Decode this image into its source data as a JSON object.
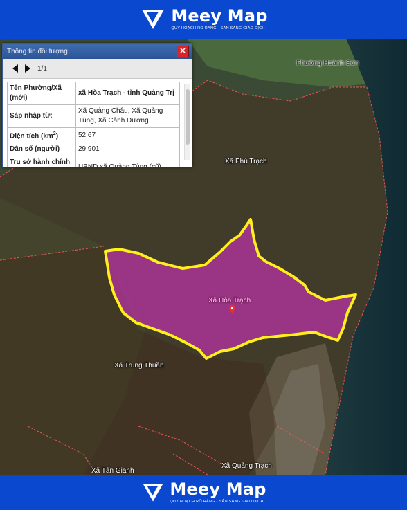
{
  "brand": {
    "name": "Meey Map",
    "tagline": "QUY HOẠCH RÕ RÀNG - SẴN SÀNG GIAO DỊCH"
  },
  "panel": {
    "title": "Thông tin đối tượng",
    "pager": "1/1",
    "rows": [
      {
        "key": "Tên Phường/Xã (mới)",
        "value": "xã Hòa Trạch - tỉnh Quảng Trị"
      },
      {
        "key": "Sáp nhập từ:",
        "value": "Xã Quảng Châu, Xã Quảng Tùng, Xã Cảnh Dương"
      },
      {
        "key_main": "Diện tích (km",
        "key_sup": "2",
        "key_end": ")",
        "value": "52,67"
      },
      {
        "key": "Dân số (người)",
        "value": "29.901"
      },
      {
        "key": "Trụ sở hành chính (mới)",
        "value": "UBND xã Quảng Tùng (cũ)"
      }
    ]
  },
  "places": {
    "hoanh_son": "Phường Hoành Sơn",
    "phu_trach": "Xã Phú Trạch",
    "hoa_trach": "Xã Hòa Trạch",
    "trung_thuan": "Xã Trung Thuần",
    "tan_gianh": "Xã Tân Gianh",
    "quang_trach": "Xã Quảng Trạch"
  },
  "colors": {
    "highlight_fill": "#b2339e",
    "highlight_stroke": "#ffef1a",
    "boundary": "#ff5a5a",
    "banner": "#0a49cf"
  }
}
